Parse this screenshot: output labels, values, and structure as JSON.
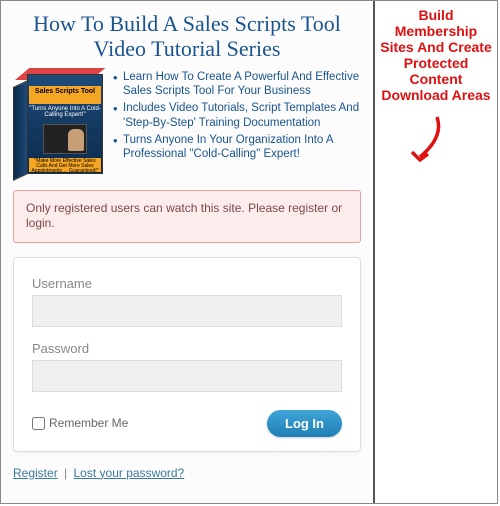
{
  "title_line1": "How To Build A Sales Scripts Tool",
  "title_line2": "Video Tutorial Series",
  "product_box": {
    "banner": "Sales Scripts Tool",
    "subtitle": "\"Turns Anyone Into A Cold-Calling Expert!\"",
    "footer": "\"Make More Effective Sales Calls And Get More Sales Appointments ... Guaranteed!\""
  },
  "bullets": [
    "Learn How To Create A Powerful And Effective Sales Scripts Tool For Your Business",
    "Includes Video Tutorials, Script Templates And 'Step-By-Step' Training Documentation",
    "Turns Anyone In Your Organization Into A Professional \"Cold-Calling\" Expert!"
  ],
  "error_message": "Only registered users can watch this site. Please register or login.",
  "form": {
    "username_label": "Username",
    "password_label": "Password",
    "remember_label": "Remember Me",
    "login_button": "Log In"
  },
  "links": {
    "register": "Register",
    "lost_password": "Lost your password?",
    "separator": "|"
  },
  "callout": {
    "line1": "Build Membership",
    "line2": "Sites And Create",
    "line3": "Protected Content",
    "line4": "Download Areas"
  }
}
